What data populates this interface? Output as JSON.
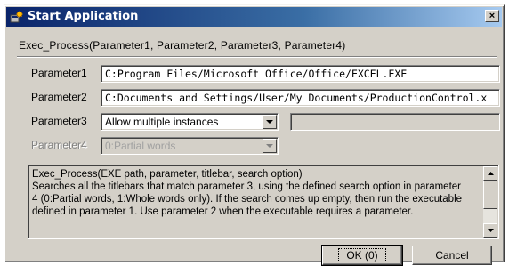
{
  "window": {
    "title": "Start Application",
    "close_glyph": "×",
    "icon": "application-icon"
  },
  "function_signature": "Exec_Process(Parameter1, Parameter2, Parameter3, Parameter4)",
  "params": {
    "p1": {
      "label": "Parameter1",
      "value": "C:Program Files/Microsoft Office/Office/EXCEL.EXE"
    },
    "p2": {
      "label": "Parameter2",
      "value": "C:Documents and Settings/User/My Documents/ProductionControl.x"
    },
    "p3": {
      "label": "Parameter3",
      "value": "Allow multiple instances",
      "extra_value": ""
    },
    "p4": {
      "label": "Parameter4",
      "value": "0:Partial words"
    }
  },
  "description": "Exec_Process(EXE path, parameter, titlebar, search option)\nSearches all the titlebars that match parameter 3, using the defined search option in parameter\n4 (0:Partial words, 1:Whole words only). If the search comes up empty, then run the executable\ndefined in parameter 1. Use parameter 2 when the executable requires a parameter.",
  "buttons": {
    "ok": "OK (0)",
    "cancel": "Cancel"
  },
  "colors": {
    "titlebar_start": "#0a246a",
    "titlebar_end": "#a6caf0",
    "face": "#d4d0c8"
  }
}
